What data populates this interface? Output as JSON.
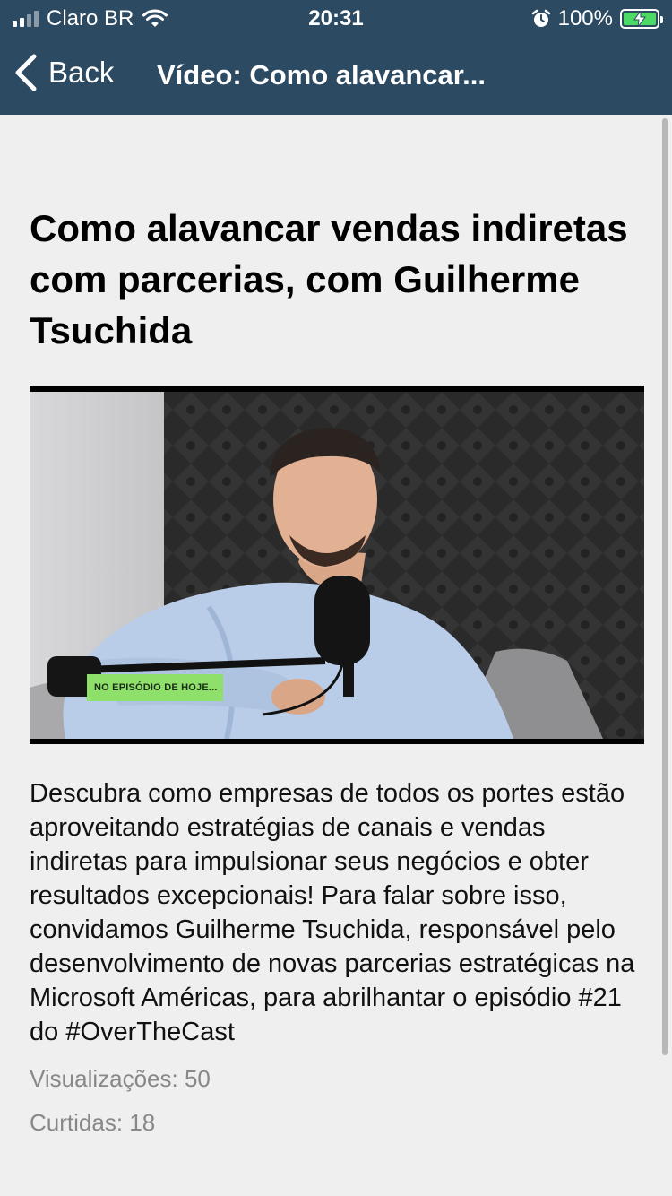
{
  "status_bar": {
    "carrier": "Claro BR",
    "time": "20:31",
    "battery_percent": "100%",
    "signal_bars": 4,
    "signal_bars_active": 2,
    "icons": [
      "signal-icon",
      "wifi-icon",
      "alarm-icon",
      "battery-charging-icon"
    ]
  },
  "nav": {
    "back_label": "Back",
    "title": "Vídeo: Como alavancar..."
  },
  "article": {
    "headline": "Como alavancar vendas indiretas com parcerias, com Guilherme Tsuchida",
    "video": {
      "caption_tag": "NO EPISÓDIO DE HOJE..."
    },
    "description": "Descubra como empresas de todos os portes estão aproveitando estratégias de canais e vendas indiretas para impulsionar seus negócios e obter resultados excepcionais! Para falar sobre isso, convidamos Guilherme Tsuchida, responsável pelo desenvolvimento de novas parcerias estratégicas na Microsoft Américas, para abrilhantar o episódio #21 do #OverTheCast",
    "views": "Visualizações: 50",
    "likes": "Curtidas: 18"
  },
  "colors": {
    "header_bg": "#2c4a62",
    "page_bg": "#efefef",
    "caption_tag_bg": "#8ee06a",
    "battery_fill": "#4cd964"
  }
}
